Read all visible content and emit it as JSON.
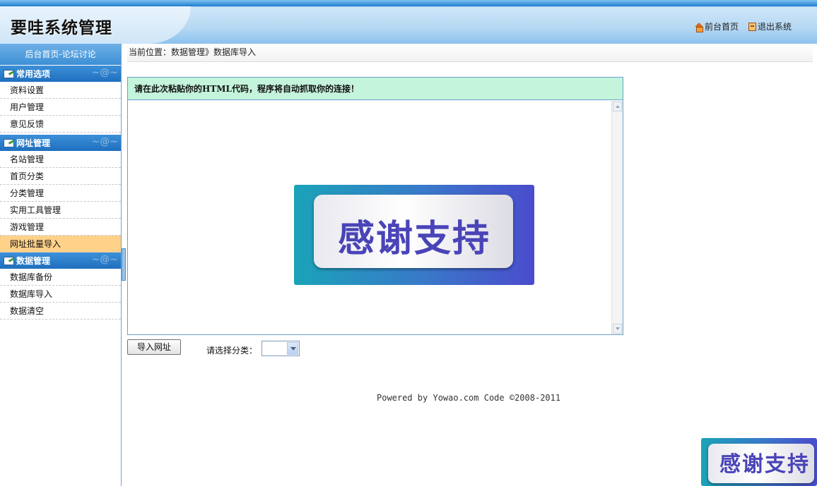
{
  "header": {
    "title": "要哇系统管理",
    "links": [
      {
        "label": "前台首页",
        "icon": "home-icon"
      },
      {
        "label": "退出系统",
        "icon": "exit-icon"
      }
    ]
  },
  "sidebar": {
    "top_label": "后台首页-论坛讨论",
    "sections": [
      {
        "title": "常用选项",
        "items": [
          "资料设置",
          "用户管理",
          "意见反馈"
        ]
      },
      {
        "title": "网址管理",
        "items": [
          "名站管理",
          "首页分类",
          "分类管理",
          "实用工具管理",
          "游戏管理",
          "网址批量导入"
        ]
      },
      {
        "title": "数据管理",
        "items": [
          "数据库备份",
          "数据库导入",
          "数据清空"
        ]
      }
    ],
    "active_item": "网址批量导入"
  },
  "main": {
    "breadcrumb": "当前位置：数据管理》数据库导入",
    "panel_heading": "请在此次粘贴你的HTML代码，程序将自动抓取你的连接！",
    "banner_text": "感谢支持",
    "import_button": "导入网址",
    "category_label": "请选择分类：",
    "category_selected": "",
    "footer": "Powered by Yowao.com Code ©2008-2011"
  },
  "corner_banner_text": "感谢支持",
  "colors": {
    "active_nav": "#ffd189",
    "panel_head": "#c4f4dc",
    "section_head": "#1f6fbf"
  }
}
